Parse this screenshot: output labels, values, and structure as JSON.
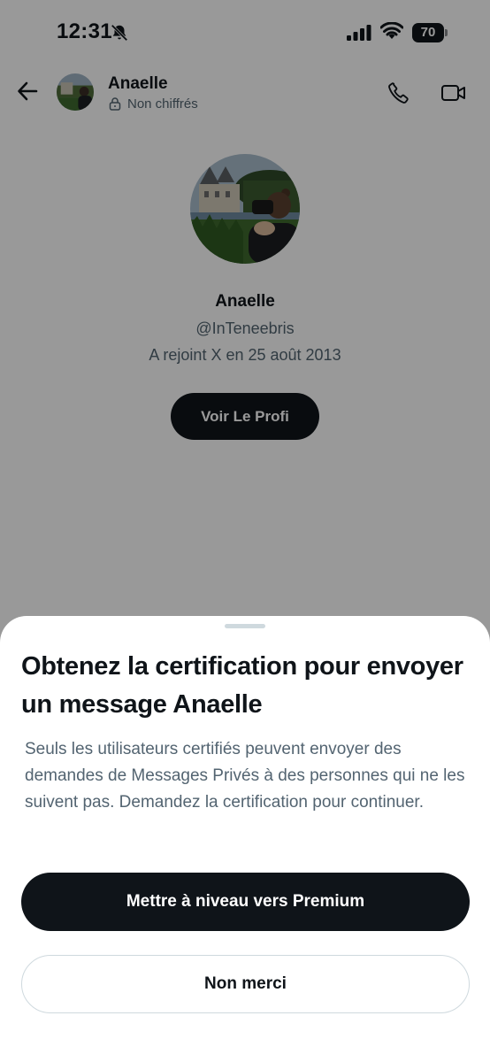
{
  "status_bar": {
    "time": "12:31",
    "battery": "70",
    "icons": [
      "bell-muted-icon",
      "signal-icon",
      "wifi-icon",
      "battery-icon"
    ]
  },
  "header": {
    "back_icon": "arrow-left-icon",
    "name": "Anaelle",
    "encryption_icon": "lock-icon",
    "encryption": "Non chiffrés",
    "call_icon": "phone-icon",
    "video_icon": "video-camera-icon"
  },
  "profile": {
    "name": "Anaelle",
    "handle": "@InTeneebris",
    "joined": "A rejoint X en 25 août 2013",
    "view_profile_label": "Voir Le Profi"
  },
  "sheet": {
    "title": "Obtenez la certification pour envoyer un message Anaelle",
    "body": "Seuls les utilisateurs certifiés peuvent envoyer des demandes de Messages Privés à des personnes qui ne les suivent pas. Demandez la certification pour continuer.",
    "primary_label": "Mettre à niveau vers Premium",
    "secondary_label": "Non merci"
  },
  "colors": {
    "primary_button": "#0f1419",
    "secondary_text": "#536471",
    "overlay": "rgba(0,0,0,0.4)"
  }
}
